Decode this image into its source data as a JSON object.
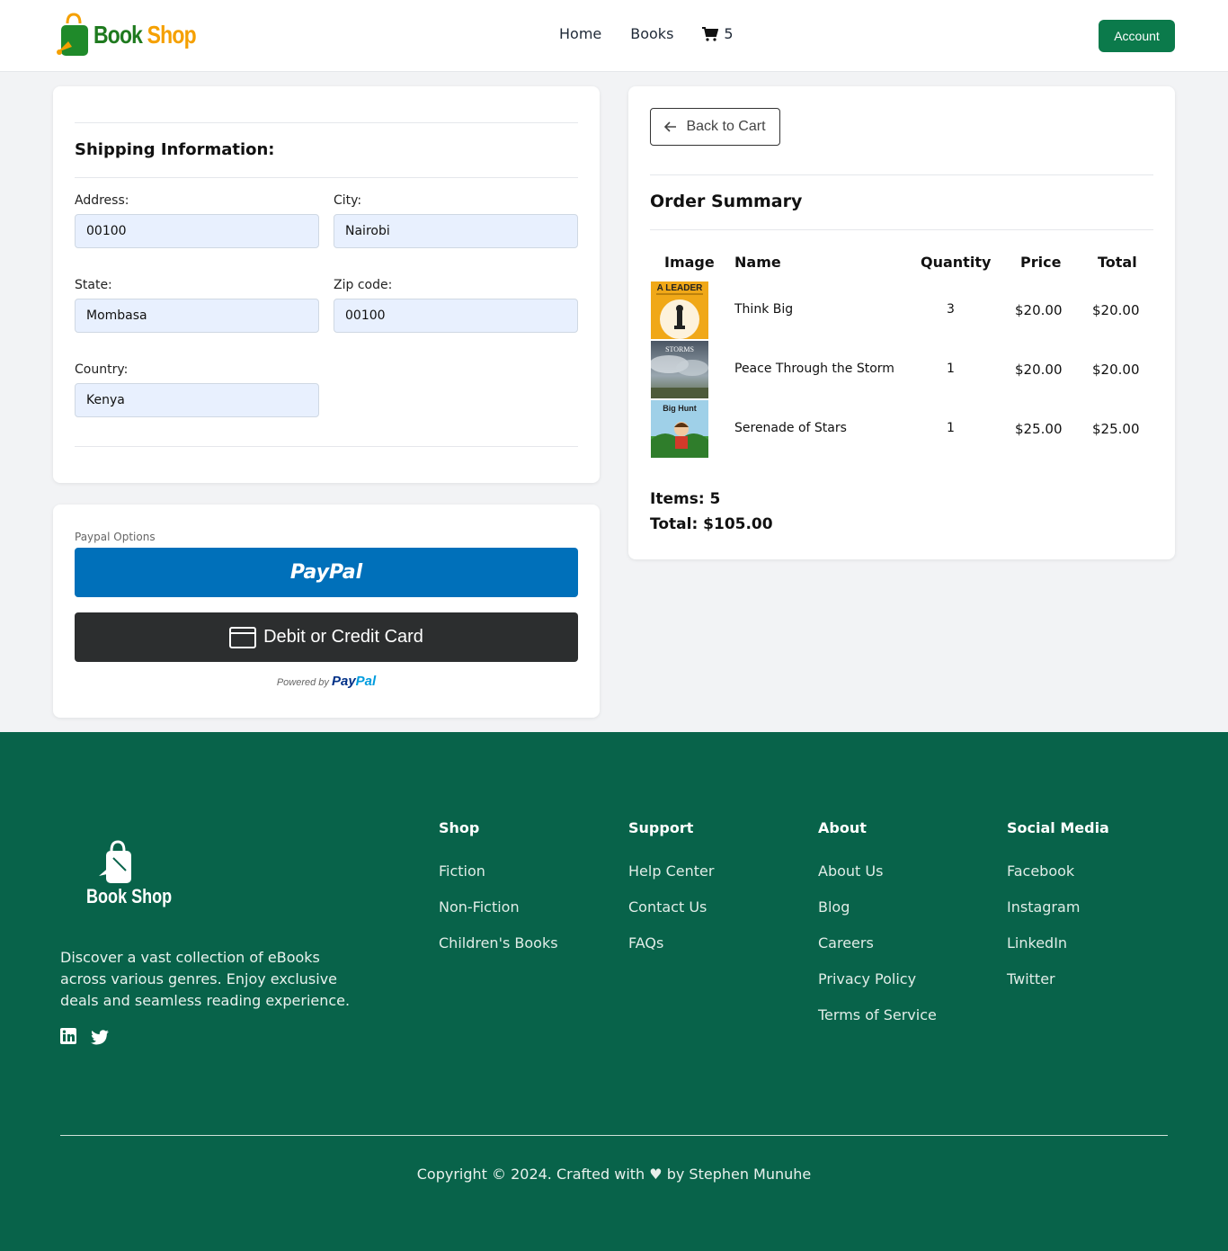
{
  "header": {
    "logo": {
      "book": "Book",
      "shop": "Shop"
    },
    "nav": {
      "home": "Home",
      "books": "Books",
      "cart_count": "5"
    },
    "account": "Account"
  },
  "shipping": {
    "title": "Shipping Information:",
    "fields": {
      "address": {
        "label": "Address:",
        "value": "00100"
      },
      "city": {
        "label": "City:",
        "value": "Nairobi"
      },
      "state": {
        "label": "State:",
        "value": "Mombasa"
      },
      "zip": {
        "label": "Zip code:",
        "value": "00100"
      },
      "country": {
        "label": "Country:",
        "value": "Kenya"
      }
    }
  },
  "payment": {
    "options_label": "Paypal Options",
    "paypal_label": "PayPal",
    "card_label": "Debit or Credit Card",
    "powered_by": "Powered by",
    "powered_brand_pay": "Pay",
    "powered_brand_pal": "Pal"
  },
  "order": {
    "back_label": "Back to Cart",
    "title": "Order Summary",
    "columns": [
      "Image",
      "Name",
      "Quantity",
      "Price",
      "Total"
    ],
    "items": [
      {
        "name": "Think Big",
        "quantity": "3",
        "price": "$20.00",
        "total": "$20.00",
        "cover_text": "A LEADER"
      },
      {
        "name": "Peace Through the Storm",
        "quantity": "1",
        "price": "$20.00",
        "total": "$20.00",
        "cover_text": "STORMS"
      },
      {
        "name": "Serenade of Stars",
        "quantity": "1",
        "price": "$25.00",
        "total": "$25.00",
        "cover_text": "Big Hunt"
      }
    ],
    "items_count": "Items: 5",
    "total": "Total: $105.00"
  },
  "footer": {
    "logo_text": "Book Shop",
    "description": "Discover a vast collection of eBooks across various genres. Enjoy exclusive deals and seamless reading experience.",
    "columns": [
      {
        "title": "Shop",
        "links": [
          "Fiction",
          "Non-Fiction",
          "Children's Books"
        ]
      },
      {
        "title": "Support",
        "links": [
          "Help Center",
          "Contact Us",
          "FAQs"
        ]
      },
      {
        "title": "About",
        "links": [
          "About Us",
          "Blog",
          "Careers",
          "Privacy Policy",
          "Terms of Service"
        ]
      },
      {
        "title": "Social Media",
        "links": [
          "Facebook",
          "Instagram",
          "LinkedIn",
          "Twitter"
        ]
      }
    ],
    "copyright": "Copyright © 2024. Crafted with ♥ by Stephen Munuhe"
  },
  "colors": {
    "brand_green": "#0b7a4b",
    "footer_bg": "#08634a",
    "paypal_blue": "#0070ba",
    "card_dark": "#2c2e2f",
    "input_bg": "#e8f0fe"
  },
  "icons": [
    "shopping-bag-logo-icon",
    "cart-icon",
    "arrow-left-icon",
    "credit-card-icon",
    "linkedin-icon",
    "twitter-icon"
  ]
}
